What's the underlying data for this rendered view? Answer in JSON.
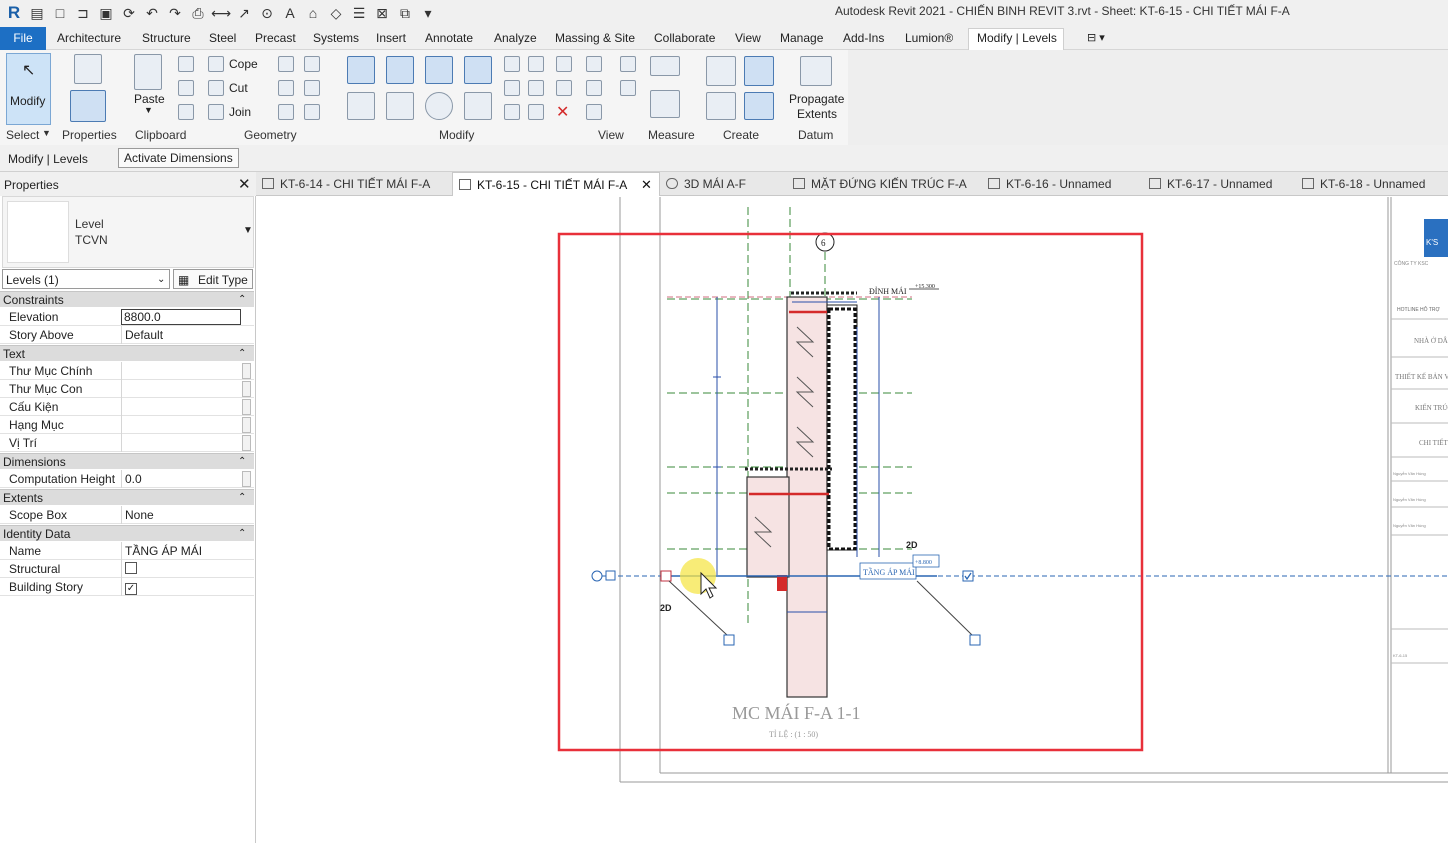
{
  "window_title": "Autodesk Revit 2021 - CHIẾN BINH REVIT 3.rvt - Sheet: KT-6-15 - CHI TIẾT MÁI F-A",
  "menu": {
    "file": "File",
    "items": [
      "Architecture",
      "Structure",
      "Steel",
      "Precast",
      "Systems",
      "Insert",
      "Annotate",
      "Analyze",
      "Massing & Site",
      "Collaborate",
      "View",
      "Manage",
      "Add-Ins",
      "Lumion®",
      "Modify | Levels"
    ]
  },
  "ribbon": {
    "modify": "Modify",
    "properties": "Properties",
    "paste": "Paste",
    "cope": "Cope",
    "cut": "Cut",
    "join": "Join",
    "propagate_1": "Propagate",
    "propagate_2": "Extents",
    "panels": {
      "select": "Select",
      "properties": "Properties",
      "clipboard": "Clipboard",
      "geometry": "Geometry",
      "modify": "Modify",
      "view": "View",
      "measure": "Measure",
      "create": "Create",
      "datum": "Datum"
    }
  },
  "options_bar": {
    "context": "Modify | Levels",
    "activate": "Activate Dimensions"
  },
  "properties": {
    "title": "Properties",
    "type_family": "Level",
    "type_name": "TCVN",
    "selector": "Levels (1)",
    "edit_type": "Edit Type",
    "groups": {
      "constraints": "Constraints",
      "text": "Text",
      "dimensions": "Dimensions",
      "extents": "Extents",
      "identity": "Identity Data"
    },
    "rows": {
      "elevation_k": "Elevation",
      "elevation_v": "8800.0",
      "story_above_k": "Story Above",
      "story_above_v": "Default",
      "thu_muc_chinh": "Thư Mục Chính",
      "thu_muc_con": "Thư Mục Con",
      "cau_kien": "Cấu Kiện",
      "hang_muc": "Hạng Mục",
      "vi_tri": "Vị Trí",
      "comp_height_k": "Computation Height",
      "comp_height_v": "0.0",
      "scope_box_k": "Scope Box",
      "scope_box_v": "None",
      "name_k": "Name",
      "name_v": "TẦNG ÁP MÁI",
      "structural": "Structural",
      "building_story": "Building Story"
    }
  },
  "tabs": [
    "KT-6-14 - CHI TIẾT MÁI F-A",
    "KT-6-15 - CHI TIẾT MÁI F-A",
    "3D MÁI A-F",
    "MẶT ĐỨNG KIẾN TRÚC F-A",
    "KT-6-16 - Unnamed",
    "KT-6-17 - Unnamed",
    "KT-6-18 - Unnamed"
  ],
  "drawing": {
    "title": "MC MÁI F-A 1-1",
    "scale": "TỈ LỆ : (1 : 50)",
    "grid_bubble": "6",
    "level_top": "ĐỈNH MÁI",
    "level_top_elev": "+15.300",
    "level_label": "TẦNG ÁP MÁI",
    "level_elev": "+8.800",
    "tag_2d": "2D"
  },
  "titleblock": {
    "lines": [
      "CÔNG TY KSC",
      "HOTLINE HỖ TRỢ",
      "NHÀ Ở DÂN DỤNG",
      "THIẾT KẾ BẢN VẼ",
      "KIẾN TRÚC",
      "CHI TIẾT",
      "Nguyễn Văn Hùng",
      "Nguyễn Văn Hùng",
      "Nguyễn Văn Hùng",
      "KT-6-15"
    ]
  },
  "colors": {
    "accent": "#1d6fc4",
    "highlight": "#e8303a",
    "level": "#2a66b3"
  }
}
